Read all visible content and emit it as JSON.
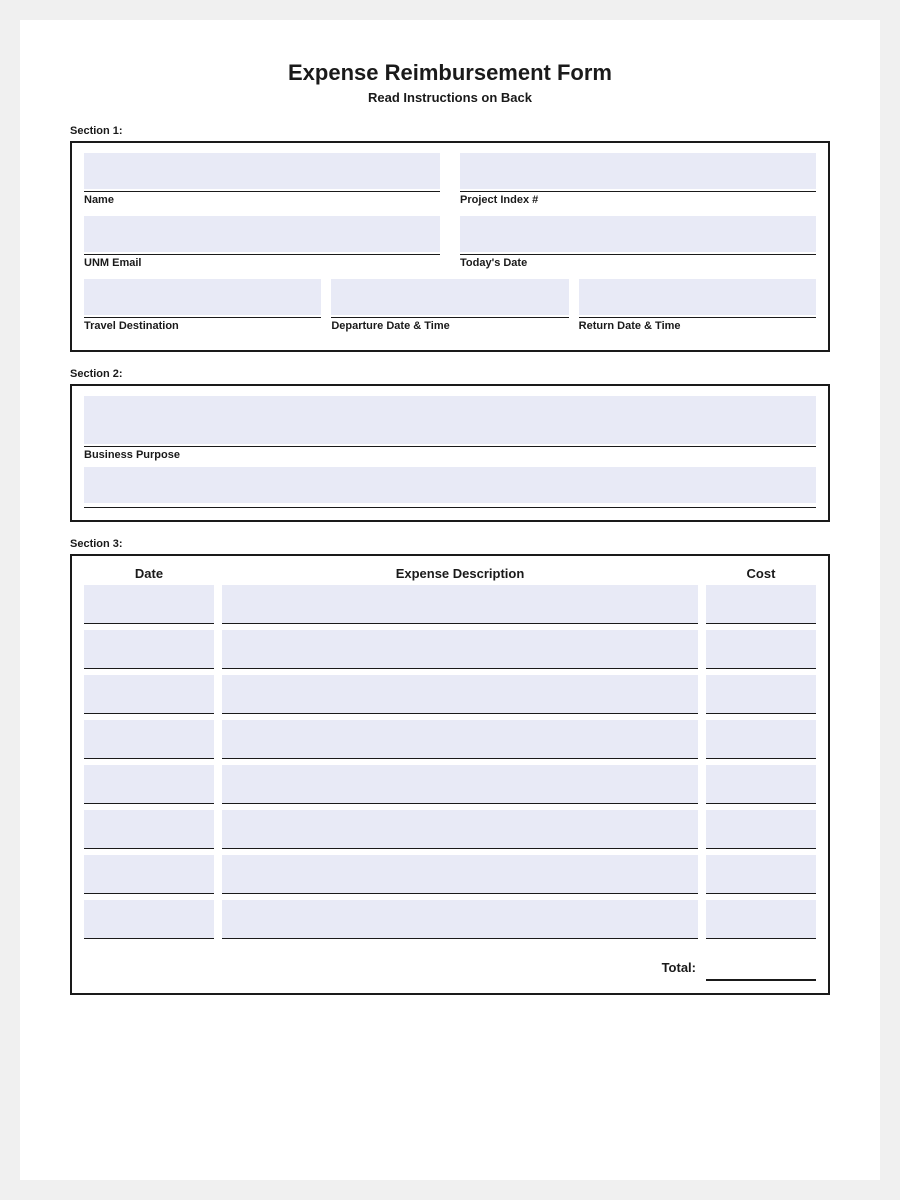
{
  "form": {
    "title": "Expense Reimbursement Form",
    "subtitle": "Read Instructions on Back"
  },
  "section1": {
    "label": "Section 1:",
    "fields": {
      "name_label": "Name",
      "project_index_label": "Project Index #",
      "unm_email_label": "UNM Email",
      "todays_date_label": "Today's Date",
      "travel_destination_label": "Travel Destination",
      "departure_label": "Departure Date & Time",
      "return_label": "Return Date & Time"
    }
  },
  "section2": {
    "label": "Section 2:",
    "fields": {
      "business_purpose_label": "Business Purpose"
    }
  },
  "section3": {
    "label": "Section 3:",
    "headers": {
      "date": "Date",
      "expense_description": "Expense Description",
      "cost": "Cost"
    },
    "total_label": "Total:",
    "rows": 8
  }
}
